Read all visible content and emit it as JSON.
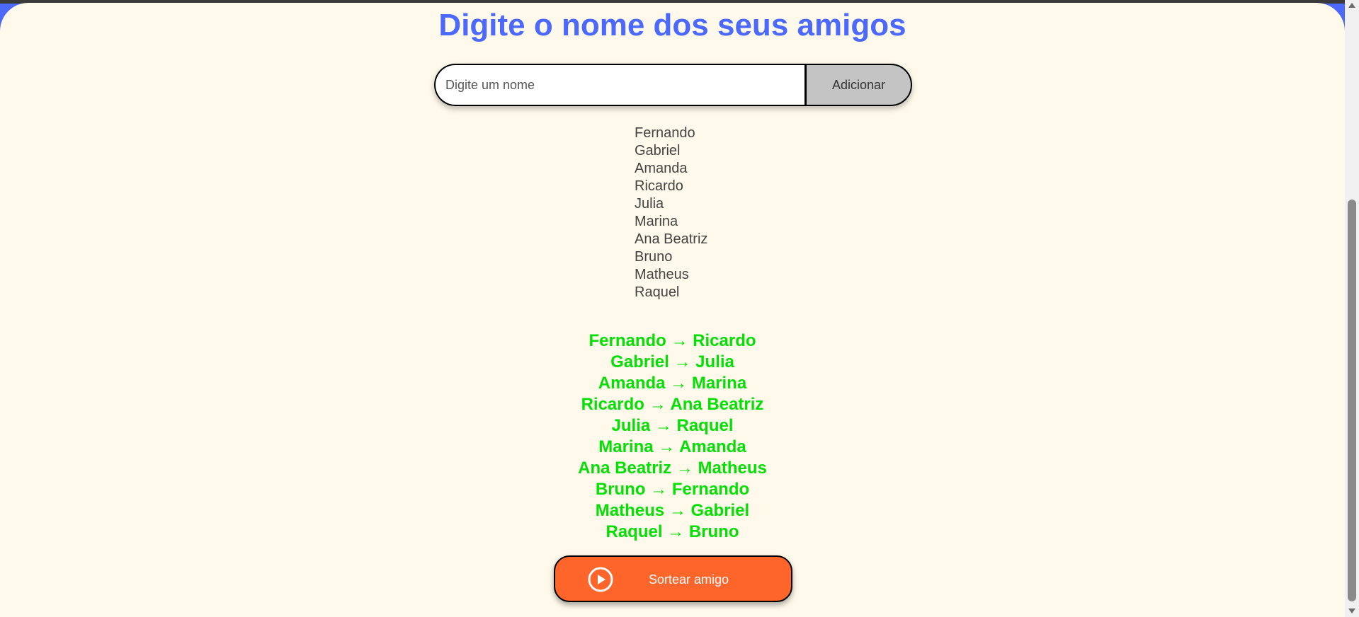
{
  "header": {
    "title": "Digite o nome dos seus amigos"
  },
  "input": {
    "placeholder": "Digite um nome",
    "value": ""
  },
  "add_button": {
    "label": "Adicionar"
  },
  "friends": [
    "Fernando",
    "Gabriel",
    "Amanda",
    "Ricardo",
    "Julia",
    "Marina",
    "Ana Beatriz",
    "Bruno",
    "Matheus",
    "Raquel"
  ],
  "results": [
    "Fernando → Ricardo",
    "Gabriel → Julia",
    "Amanda → Marina",
    "Ricardo → Ana Beatriz",
    "Julia → Raquel",
    "Marina → Amanda",
    "Ana Beatriz → Matheus",
    "Bruno → Fernando",
    "Matheus → Gabriel",
    "Raquel → Bruno"
  ],
  "draw_button": {
    "label": "Sortear amigo",
    "icon": "play-circle-icon"
  },
  "colors": {
    "title": "#4b69fd",
    "background": "#fff9eb",
    "result_text": "#05df05",
    "draw_button": "#fe652b",
    "add_button": "#c4c4c4"
  }
}
